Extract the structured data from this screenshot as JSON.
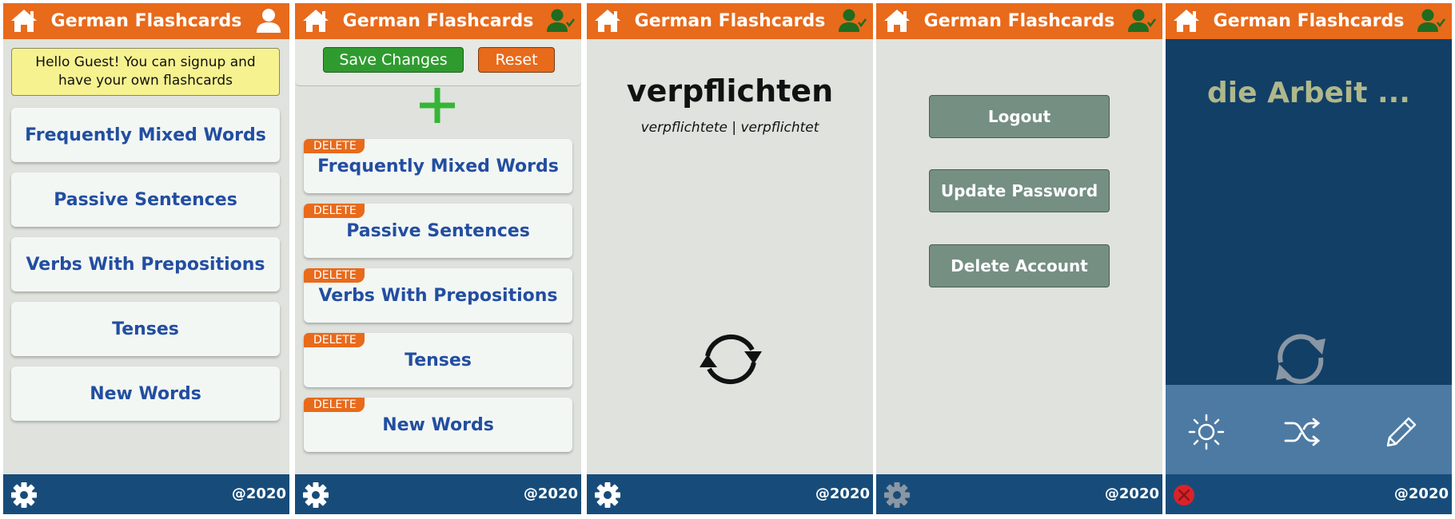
{
  "app_title": "German Flashcards",
  "footer_copyright": "@2020",
  "colors": {
    "header": "#e86a1b",
    "footer": "#174c7a",
    "card_text": "#234ea0",
    "save": "#2f9b2f",
    "reset": "#e86a1b",
    "account_button": "#758f83",
    "flash_bg": "#123f66",
    "flash_word": "#b0b88a",
    "tool_bar": "#4d7aa3"
  },
  "screen1": {
    "notice": "Hello Guest! You can signup and have your own flashcards",
    "decks": [
      "Frequently Mixed Words",
      "Passive Sentences",
      "Verbs With Prepositions",
      "Tenses",
      "New Words"
    ]
  },
  "screen2": {
    "save_label": "Save Changes",
    "reset_label": "Reset",
    "delete_label": "DELETE",
    "decks": [
      "Frequently Mixed Words",
      "Passive Sentences",
      "Verbs With Prepositions",
      "Tenses",
      "New Words"
    ]
  },
  "screen3": {
    "word": "verpflichten",
    "forms": "verpflichtete | verpflichtet"
  },
  "screen4": {
    "buttons": [
      "Logout",
      "Update Password",
      "Delete Account"
    ]
  },
  "screen5": {
    "word": "die Arbeit ...",
    "tools": [
      "sun-icon",
      "shuffle-icon",
      "pencil-icon"
    ]
  }
}
